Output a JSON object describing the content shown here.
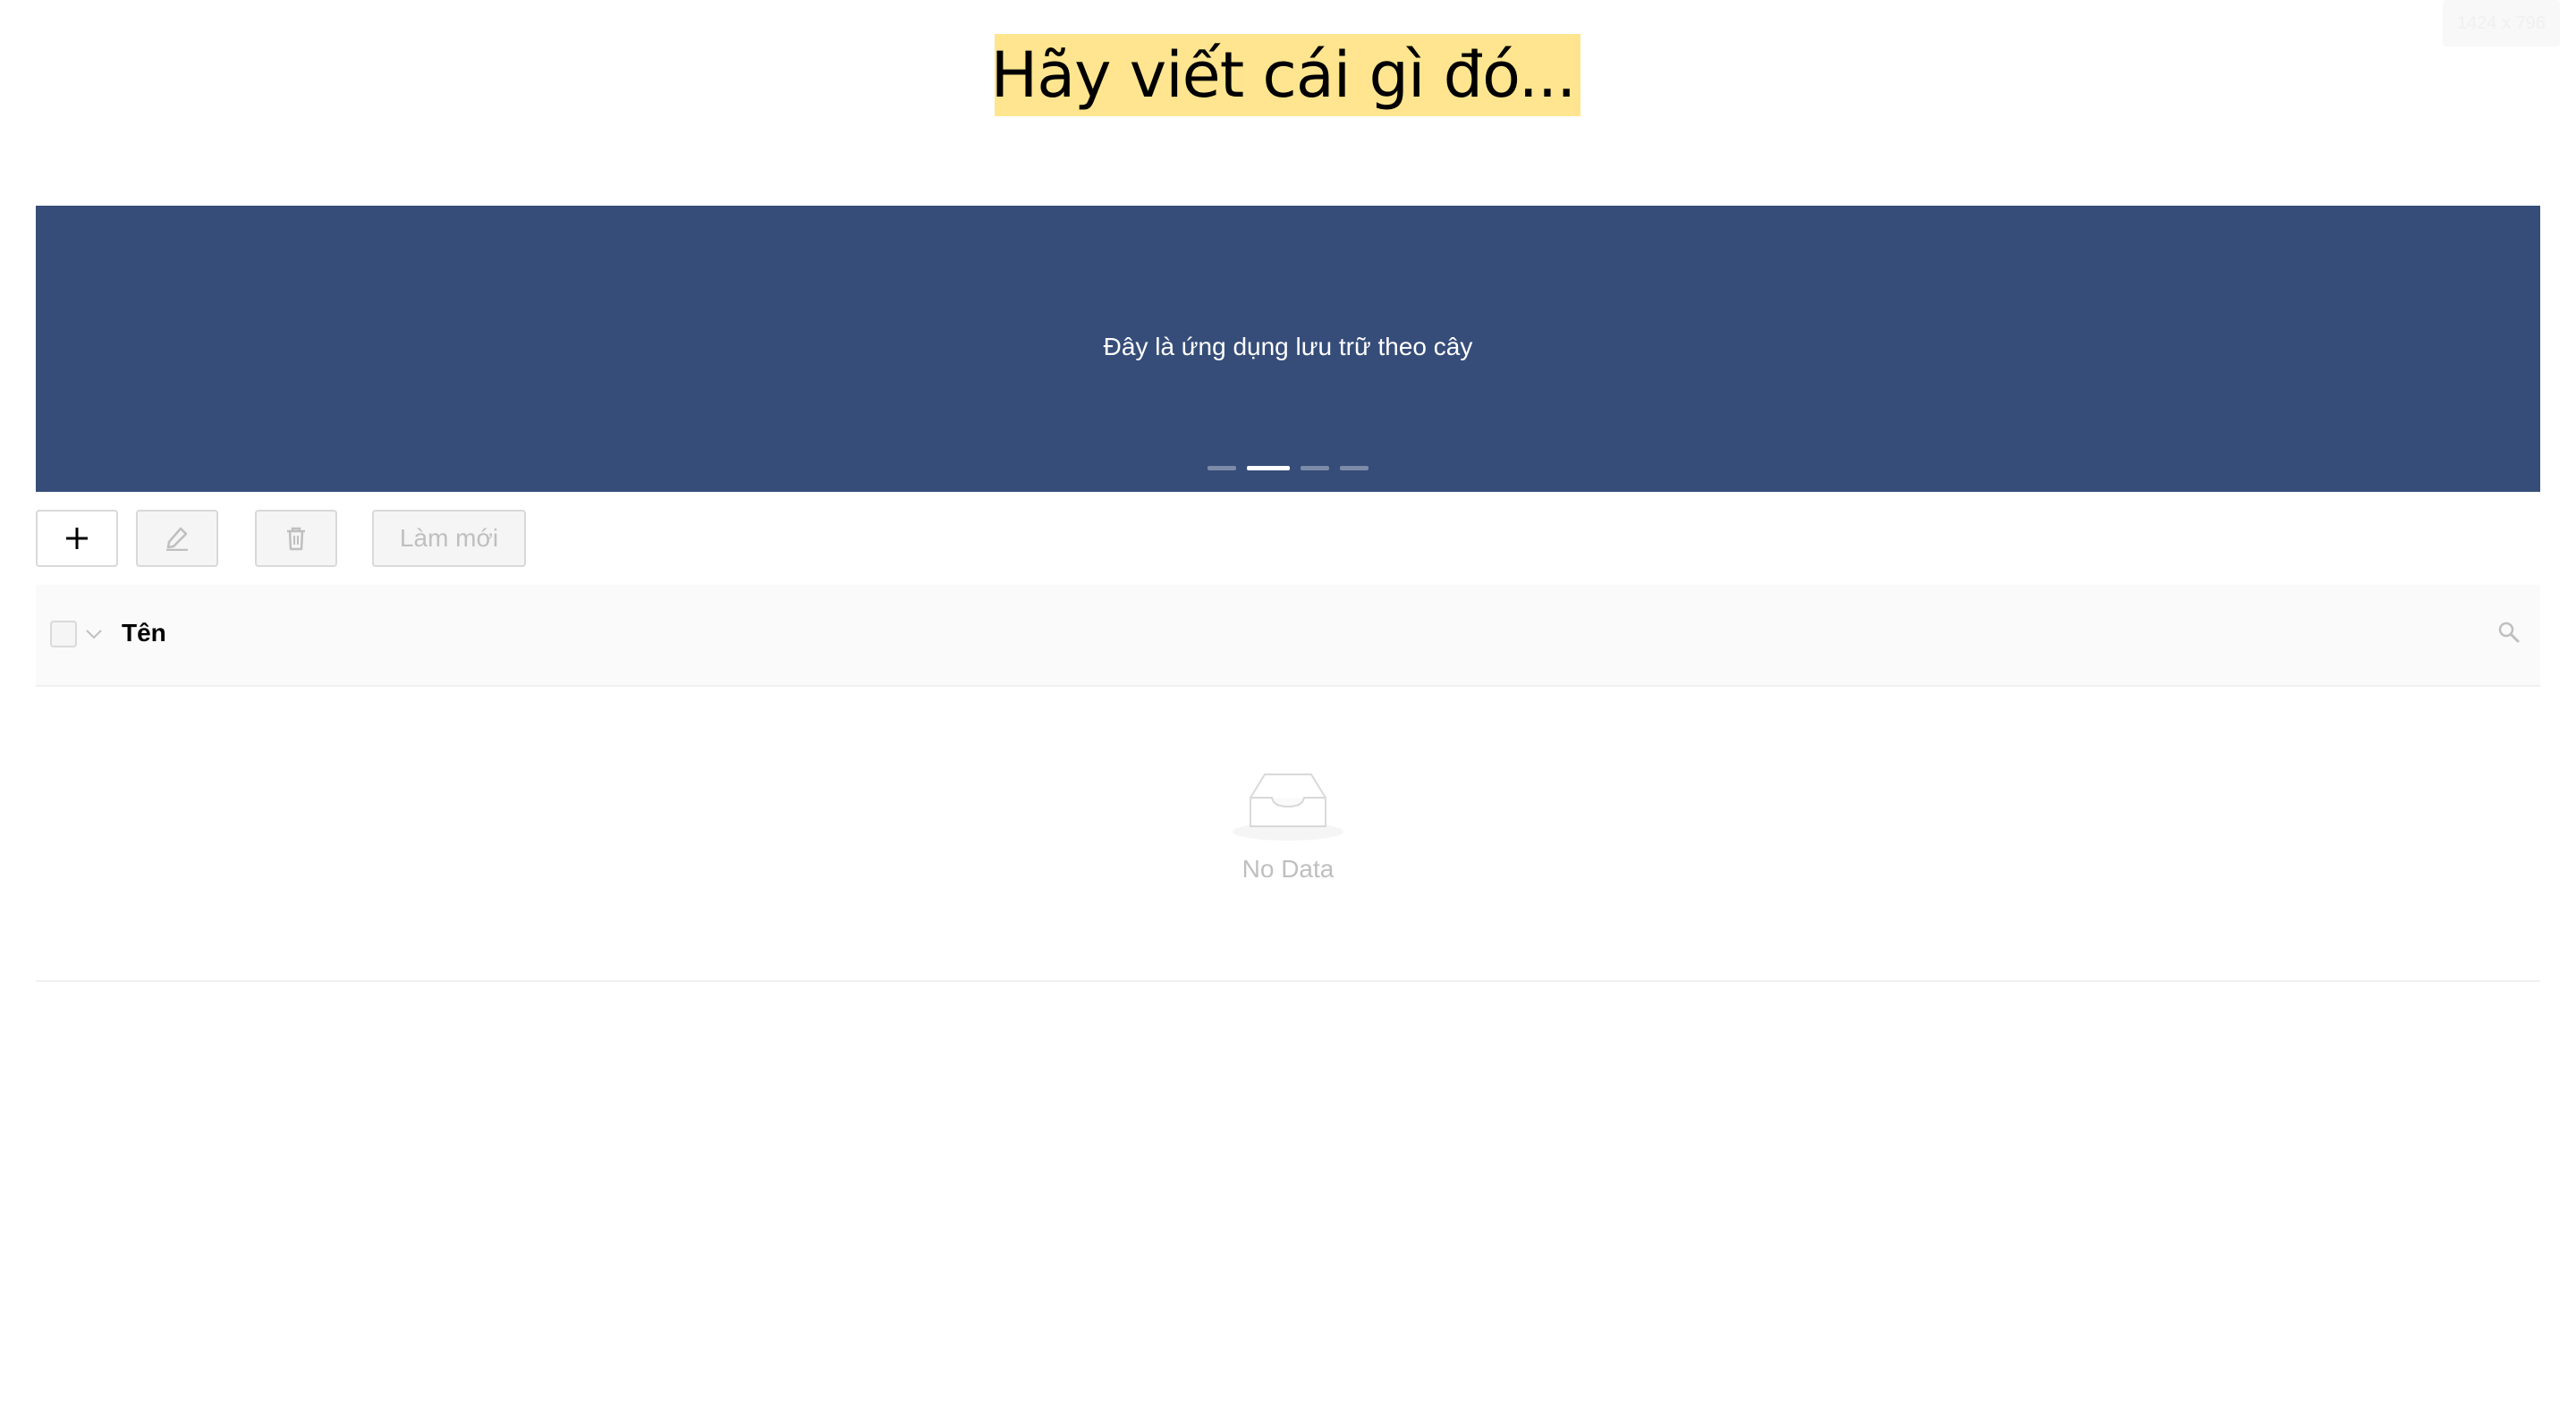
{
  "size_badge": "1424 x 796",
  "title": {
    "text": "Hãy viết cái gì đó...",
    "edit_icon": "edit-pencil-icon",
    "background": "#ffe58f",
    "icon_color": "#1890ff"
  },
  "carousel": {
    "text": "Đây là ứng dụng lưu trữ theo cây",
    "background": "#364d79",
    "slide_count": 4,
    "active_index": 1
  },
  "toolbar": {
    "add_icon": "plus-icon",
    "edit_icon": "edit-icon",
    "delete_icon": "trash-icon",
    "refresh_label": "Làm mới"
  },
  "table": {
    "column_title": "Tên",
    "search_icon": "search-icon",
    "empty_text": "No Data"
  }
}
